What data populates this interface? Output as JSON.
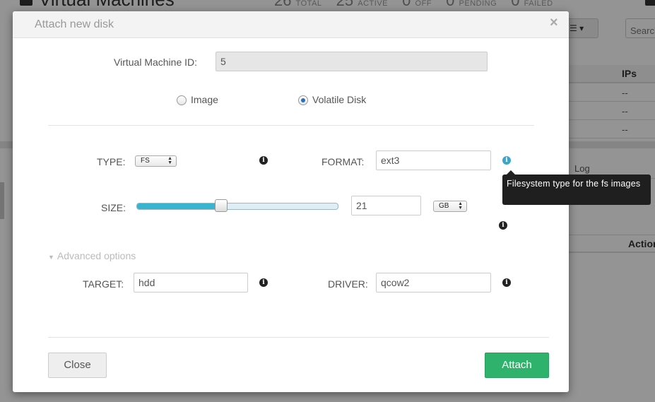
{
  "background": {
    "title": "Virtual Machines",
    "stats": [
      {
        "count": "26",
        "label": "TOTAL"
      },
      {
        "count": "25",
        "label": "ACTIVE"
      },
      {
        "count": "0",
        "label": "OFF"
      },
      {
        "count": "0",
        "label": "PENDING"
      },
      {
        "count": "0",
        "label": "FAILED"
      }
    ],
    "search_placeholder": "Search",
    "table_header_ips": "IPs",
    "table_rows": [
      "--",
      "--",
      "--"
    ],
    "tab_log": "Log",
    "actions_header": "Actions"
  },
  "modal": {
    "title": "Attach new disk",
    "close_glyph": "×",
    "vm_id_label": "Virtual Machine ID:",
    "vm_id_value": "5",
    "radio_image_label": "Image",
    "radio_volatile_label": "Volatile Disk",
    "selected_radio": "volatile",
    "type_label": "TYPE:",
    "type_value": "FS",
    "format_label": "FORMAT:",
    "format_value": "ext3",
    "tooltip_text": "Filesystem type for the fs images",
    "size_label": "SIZE:",
    "size_value": "21",
    "size_slider_fraction": 0.42,
    "size_unit": "GB",
    "advanced_label": "Advanced options",
    "target_label": "TARGET:",
    "target_value": "hdd",
    "driver_label": "DRIVER:",
    "driver_value": "qcow2",
    "close_button": "Close",
    "attach_button": "Attach"
  },
  "colors": {
    "attach_green": "#2fb36c",
    "slider_fill": "#37b4d0",
    "info_blue": "#3aa7c9",
    "tooltip_bg": "#1f1f1f"
  }
}
